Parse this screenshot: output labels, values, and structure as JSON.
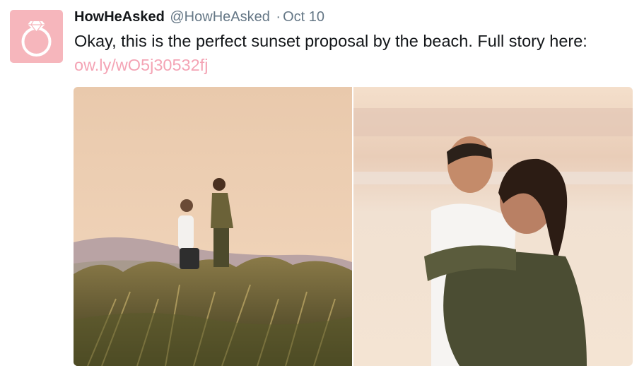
{
  "tweet": {
    "author_name": "HowHeAsked",
    "author_handle": "@HowHeAsked",
    "separator": "·",
    "date": "Oct 10",
    "text": "Okay, this is the perfect sunset proposal by the beach. Full story here:",
    "link": "ow.ly/wO5j30532fj",
    "link_color": "#f4a4b5",
    "avatar": {
      "icon": "diamond-ring-icon",
      "background_color": "#f6b6bc"
    },
    "media": [
      {
        "icon": "photo-proposal-in-dunes"
      },
      {
        "icon": "photo-couple-hugging-on-beach"
      }
    ]
  }
}
